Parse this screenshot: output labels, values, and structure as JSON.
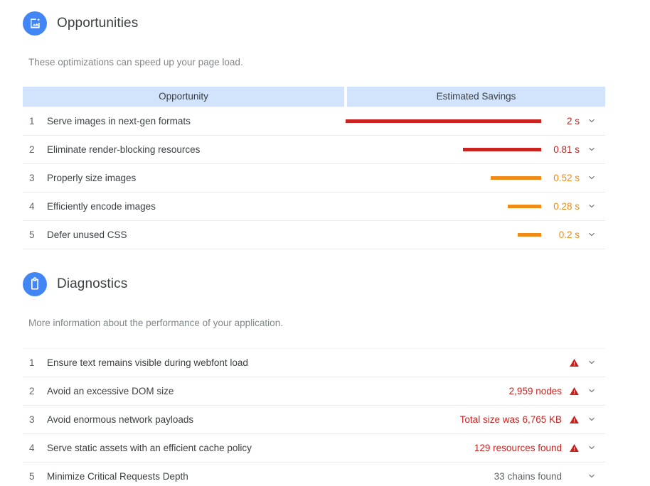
{
  "colors": {
    "accent_blue": "#4285f4",
    "header_bg": "#d2e3fc",
    "red": "#c5221f",
    "bar_red": "#c9221f",
    "orange": "#ef8b16",
    "bar_orange": "#ef8b16",
    "text": "#3c4043",
    "muted": "#80868b",
    "row_border": "#e8eaed"
  },
  "opportunities": {
    "icon": "image-plus-icon",
    "title": "Opportunities",
    "description": "These optimizations can speed up your page load.",
    "columns": [
      "Opportunity",
      "Estimated Savings"
    ],
    "rows": [
      {
        "index": "1",
        "title": "Serve images in next-gen formats",
        "savings": "2 s",
        "severity": "red",
        "bar_width_pct": 100,
        "expand_icon": "chevron-down-icon"
      },
      {
        "index": "2",
        "title": "Eliminate render-blocking resources",
        "savings": "0.81 s",
        "severity": "red",
        "bar_width_pct": 40,
        "expand_icon": "chevron-down-icon"
      },
      {
        "index": "3",
        "title": "Properly size images",
        "savings": "0.52 s",
        "severity": "orange",
        "bar_width_pct": 26,
        "expand_icon": "chevron-down-icon"
      },
      {
        "index": "4",
        "title": "Efficiently encode images",
        "savings": "0.28 s",
        "severity": "orange",
        "bar_width_pct": 17,
        "expand_icon": "chevron-down-icon"
      },
      {
        "index": "5",
        "title": "Defer unused CSS",
        "savings": "0.2 s",
        "severity": "orange",
        "bar_width_pct": 12,
        "expand_icon": "chevron-down-icon"
      }
    ]
  },
  "diagnostics": {
    "icon": "clipboard-icon",
    "title": "Diagnostics",
    "description": "More information about the performance of your application.",
    "rows": [
      {
        "index": "1",
        "title": "Ensure text remains visible during webfont load",
        "value": "",
        "severity": "red",
        "has_warning": true,
        "expand_icon": "chevron-down-icon"
      },
      {
        "index": "2",
        "title": "Avoid an excessive DOM size",
        "value": "2,959 nodes",
        "severity": "red",
        "has_warning": true,
        "expand_icon": "chevron-down-icon"
      },
      {
        "index": "3",
        "title": "Avoid enormous network payloads",
        "value": "Total size was 6,765 KB",
        "severity": "red",
        "has_warning": true,
        "expand_icon": "chevron-down-icon"
      },
      {
        "index": "4",
        "title": "Serve static assets with an efficient cache policy",
        "value": "129 resources found",
        "severity": "red",
        "has_warning": true,
        "expand_icon": "chevron-down-icon"
      },
      {
        "index": "5",
        "title": "Minimize Critical Requests Depth",
        "value": "33 chains found",
        "severity": "grey",
        "has_warning": false,
        "expand_icon": "chevron-down-icon"
      }
    ]
  }
}
